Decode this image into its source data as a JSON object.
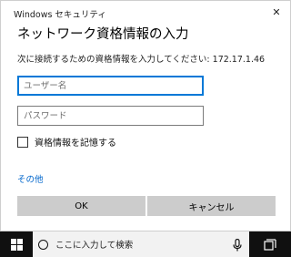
{
  "dialog": {
    "window_title": "Windows セキュリティ",
    "heading": "ネットワーク資格情報の入力",
    "prompt": "次に接続するための資格情報を入力してください: 172.17.1.46",
    "username_placeholder": "ユーザー名",
    "username_value": "",
    "password_placeholder": "パスワード",
    "password_value": "",
    "remember_label": "資格情報を記憶する",
    "remember_checked": false,
    "more_link": "その他",
    "ok_label": "OK",
    "cancel_label": "キャンセル",
    "close_symbol": "✕"
  },
  "taskbar": {
    "search_text": "ここに入力して検索",
    "icons": [
      "windows-logo",
      "search-circle",
      "microphone",
      "task-view"
    ]
  },
  "colors": {
    "accent": "#0078d7",
    "link": "#0066cc",
    "button_bg": "#cccccc",
    "taskbar_bg": "#101010"
  }
}
